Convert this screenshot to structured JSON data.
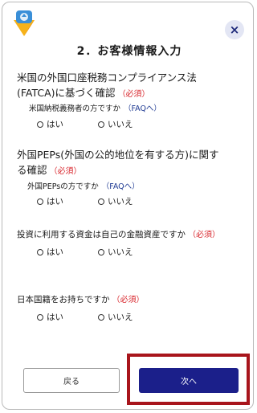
{
  "header": {
    "close_label": "×",
    "title": "2．お客様情報入力"
  },
  "required_label": "（必須）",
  "questions": [
    {
      "title_line1": "米国の外国口座税務コンプライアンス法",
      "title_line2": "(FATCA)に基づく確認",
      "sub": "米国納税義務者の方ですか",
      "faq": "（FAQへ）",
      "yes": "はい",
      "no": "いいえ"
    },
    {
      "title_line1": "外国PEPs(外国の公的地位を有する方)に関す",
      "title_line2": "る確認",
      "sub": "外国PEPsの方ですか",
      "faq": "（FAQへ）",
      "yes": "はい",
      "no": "いいえ"
    },
    {
      "title_line1": "投資に利用する資金は自己の金融資産ですか",
      "yes": "はい",
      "no": "いいえ"
    },
    {
      "title_line1": "日本国籍をお持ちですか",
      "yes": "はい",
      "no": "いいえ"
    }
  ],
  "footer": {
    "back_label": "戻る",
    "next_label": "次へ"
  },
  "colors": {
    "accent": "#1b1f8a",
    "required": "#d8262c",
    "highlight": "#a8151c"
  }
}
